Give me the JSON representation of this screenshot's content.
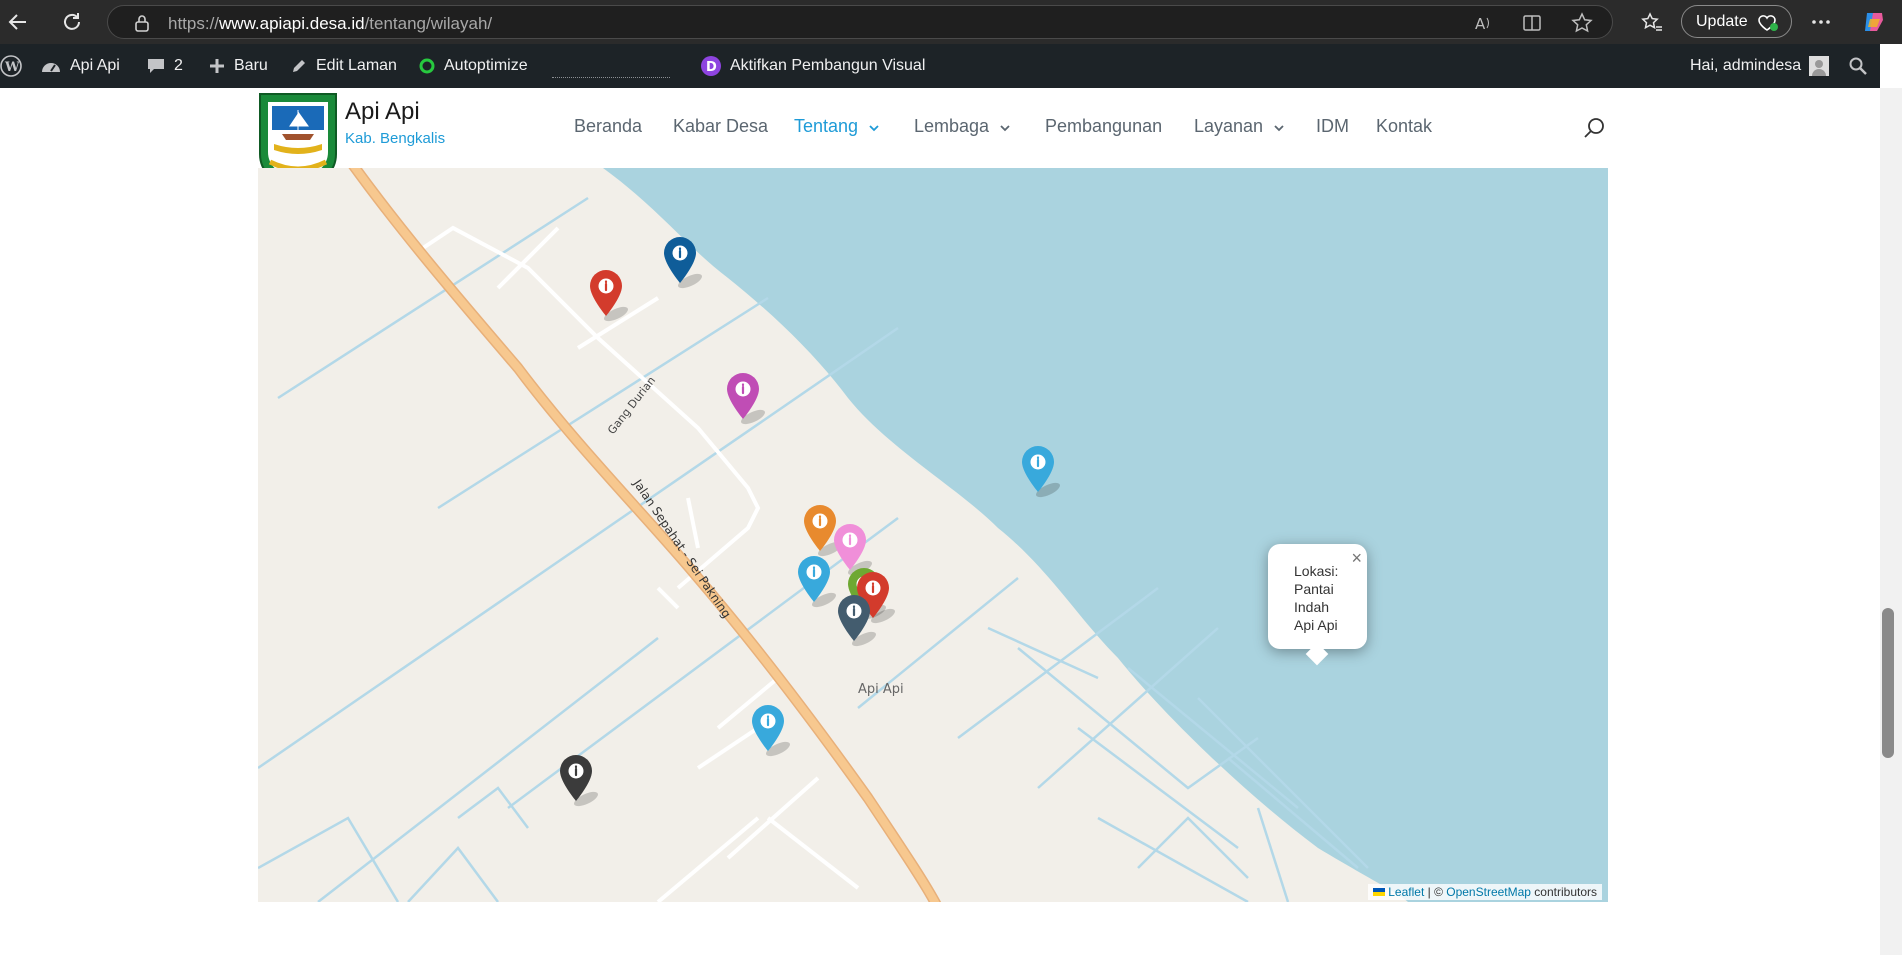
{
  "browser": {
    "url_prefix": "https://",
    "url_domain": "www.apiapi.desa.id",
    "url_path": "/tentang/wilayah/",
    "update_label": "Update"
  },
  "admin_bar": {
    "site_name": "Api Api",
    "comments_count": "2",
    "new_label": "Baru",
    "edit_label": "Edit Laman",
    "autoptimize_label": "Autoptimize",
    "visual_builder_label": "Aktifkan Pembangun Visual",
    "greeting": "Hai, admindesa",
    "colors": {
      "background": "#1d2327",
      "autoptimize_dot": "#27c93f",
      "divi_badge": "#8e44e0"
    }
  },
  "site": {
    "title": "Api Api",
    "tagline": "Kab. Bengkalis",
    "nav": [
      {
        "label": "Beranda",
        "active": false
      },
      {
        "label": "Kabar Desa",
        "active": false
      },
      {
        "label": "Tentang",
        "active": true,
        "dropdown": true
      },
      {
        "label": "Lembaga",
        "active": false,
        "dropdown": true
      },
      {
        "label": "Pembangunan",
        "active": false
      },
      {
        "label": "Layanan",
        "active": false,
        "dropdown": true
      },
      {
        "label": "IDM",
        "active": false
      },
      {
        "label": "Kontak",
        "active": false
      }
    ],
    "accent_color": "#1e9bd7"
  },
  "map": {
    "road_labels": {
      "main": "Jalan Sepahat - Sei Pakning",
      "lane": "Gang Durian",
      "village": "Api Api"
    },
    "popup": {
      "text": "Lokasi:\nPantai\nIndah\nApi Api",
      "close": "×"
    },
    "attribution": {
      "leaflet": "Leaflet",
      "separator": " | © ",
      "osm": "OpenStreetMap",
      "suffix": " contributors"
    },
    "marker_icon": "info-icon",
    "marker_colors": [
      "#0f5d99",
      "#d33b2c",
      "#c04db5",
      "#e88a2e",
      "#f08fd9",
      "#38a9dc",
      "#6ea832",
      "#d33b2c",
      "#435c6e",
      "#38a9dc",
      "#38a9dc",
      "#3b3b3b"
    ],
    "colors": {
      "water": "#aad3df",
      "land": "#f2efe9",
      "main_road": "#f7c88f",
      "canal": "#b3d8e8"
    }
  }
}
